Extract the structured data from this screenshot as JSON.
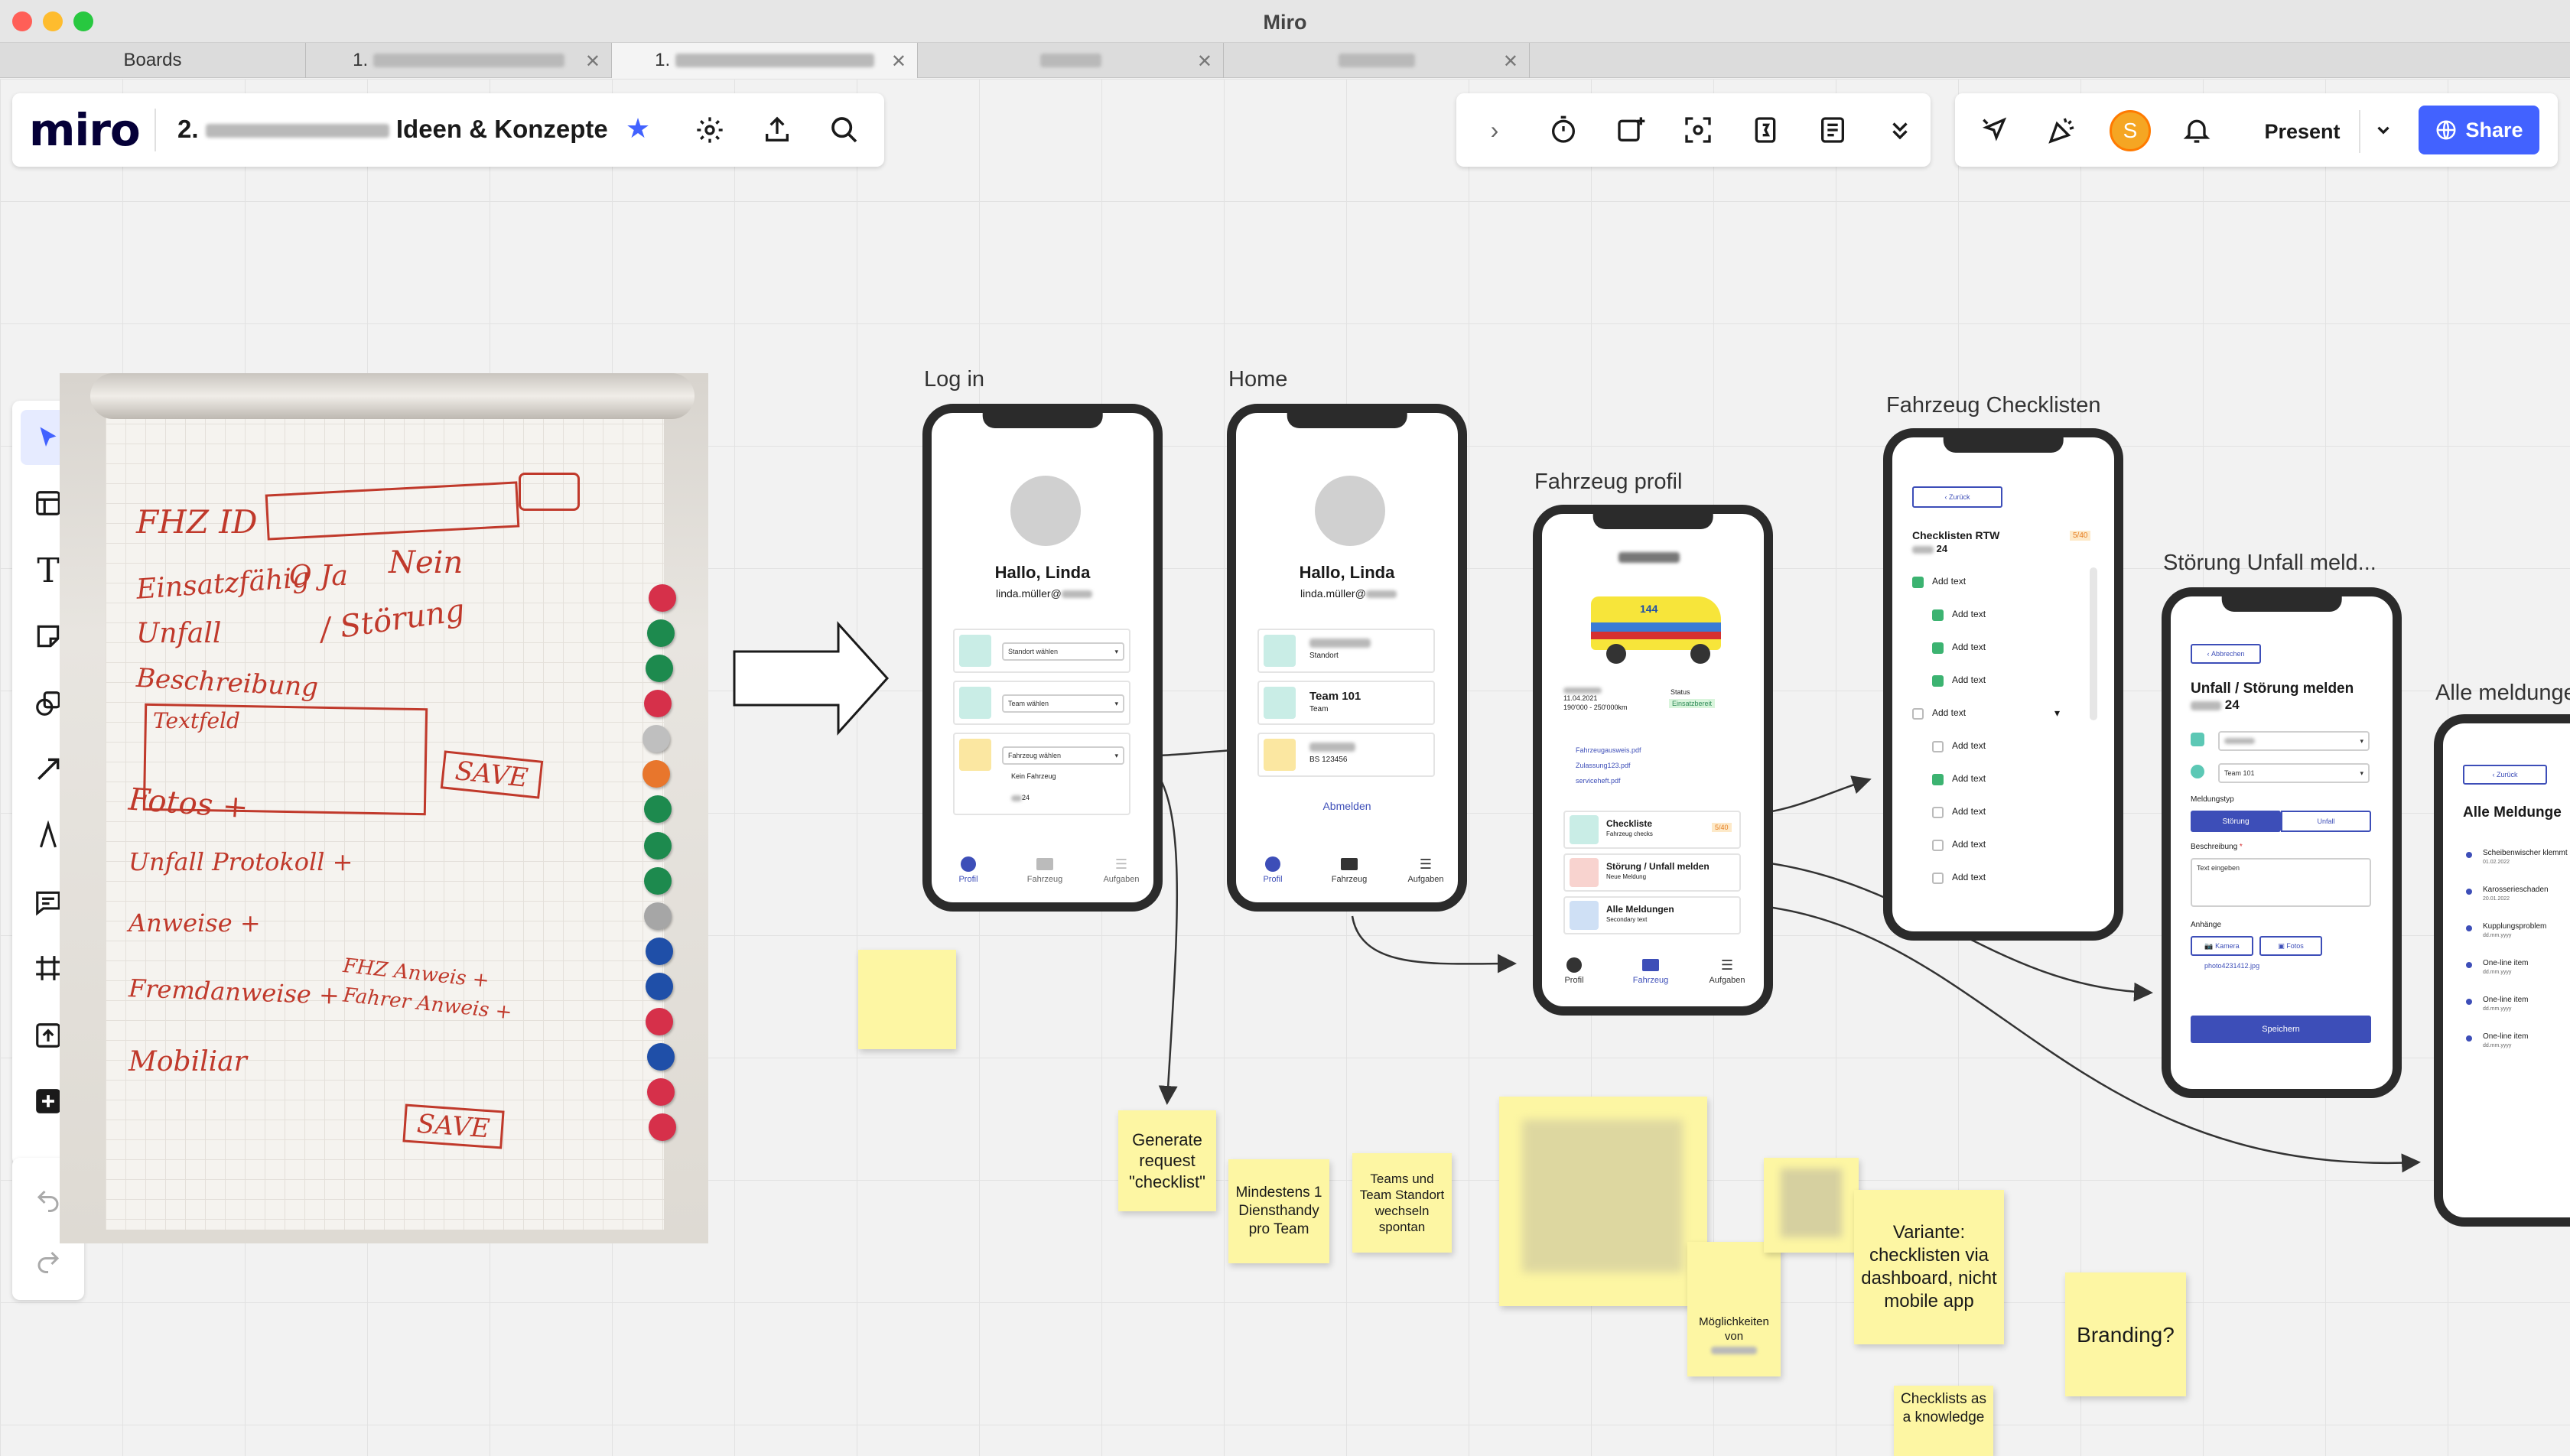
{
  "window": {
    "title": "Miro"
  },
  "tabs": [
    {
      "label": "Boards"
    },
    {
      "label": "1."
    },
    {
      "label": "1."
    },
    {
      "label": ""
    },
    {
      "label": ""
    }
  ],
  "header": {
    "logo": "miro",
    "board_title_prefix": "2.",
    "board_title": "Ideen & Konzepte",
    "present_label": "Present",
    "share_label": "Share",
    "avatar_initial": "S"
  },
  "photo": {
    "lines": [
      "FHZ ID",
      "Einsatzfähig",
      "O Ja",
      "Nein",
      "Unfall",
      "/ Störung",
      "Beschreibung",
      "Textfeld",
      "SAVE",
      "Fotos +",
      "Unfall Protokoll +",
      "Anweise +",
      "Fremdanweise +",
      "FHZ Anweis +",
      "Fahrer Anweis +",
      "Mobiliar",
      "SAVE"
    ]
  },
  "frames": {
    "login": "Log in",
    "home": "Home",
    "fahrzeug_profil": "Fahrzeug profil",
    "checklisten": "Fahrzeug Checklisten",
    "stoerung": "Störung Unfall meld...",
    "alle_meldungen": "Alle meldunge"
  },
  "login": {
    "greeting": "Hallo, Linda",
    "email": "linda.müller@",
    "standort": "Standort wählen",
    "team": "Team wählen",
    "fahrzeug": "Fahrzeug wählen",
    "dropdown_1": "Kein Fahrzeug",
    "dropdown_2": "24",
    "nav": [
      "Profil",
      "Fahrzeug",
      "Aufgaben"
    ]
  },
  "home": {
    "greeting": "Hallo, Linda",
    "email": "linda.müller@",
    "standort_label": "Standort",
    "team_value": "Team 101",
    "team_label": "Team",
    "vehicle_code": "BS 123456",
    "logout": "Abmelden",
    "nav": [
      "Profil",
      "Fahrzeug",
      "Aufgaben"
    ]
  },
  "profil": {
    "vehicle_number": "144",
    "date": "11.04.2021",
    "km": "190'000 - 250'000km",
    "status_label": "Status",
    "status_value": "Einsatzbereit",
    "files": [
      "Fahrzeugausweis.pdf",
      "Zulassung123.pdf",
      "serviceheft.pdf"
    ],
    "cards": [
      {
        "title": "Checkliste",
        "sub": "Fahrzeug checks",
        "badge": "5/40"
      },
      {
        "title": "Störung / Unfall melden",
        "sub": "Neue Meldung",
        "badge": ""
      },
      {
        "title": "Alle Meldungen",
        "sub": "Secondary text",
        "badge": ""
      }
    ],
    "nav": [
      "Profil",
      "Fahrzeug",
      "Aufgaben"
    ]
  },
  "checklisten": {
    "back": "Zurück",
    "title": "Checklisten RTW",
    "subtitle": "24",
    "badge": "5/40",
    "items": [
      {
        "label": "Add text",
        "checked": true,
        "indent": false
      },
      {
        "label": "Add text",
        "checked": true,
        "indent": true
      },
      {
        "label": "Add text",
        "checked": true,
        "indent": true
      },
      {
        "label": "Add text",
        "checked": true,
        "indent": true
      },
      {
        "label": "Add text",
        "checked": false,
        "indent": false
      },
      {
        "label": "Add text",
        "checked": false,
        "indent": true
      },
      {
        "label": "Add text",
        "checked": true,
        "indent": true
      },
      {
        "label": "Add text",
        "checked": false,
        "indent": true
      },
      {
        "label": "Add text",
        "checked": false,
        "indent": true
      },
      {
        "label": "Add text",
        "checked": false,
        "indent": true
      }
    ]
  },
  "stoerung": {
    "back": "Abbrechen",
    "title": "Unfall / Störung melden",
    "subtitle": "24",
    "team": "Team 101",
    "meldungstyp": "Meldungstyp",
    "opt1": "Störung",
    "opt2": "Unfall",
    "beschreibung": "Beschreibung",
    "text_placeholder": "Text eingeben",
    "anhaenge": "Anhänge",
    "kamera": "Kamera",
    "fotos": "Fotos",
    "file": "photo4231412.jpg",
    "save": "Speichern"
  },
  "alle": {
    "back": "Zurück",
    "title": "Alle Meldunge",
    "items": [
      {
        "title": "Scheibenwischer klemmt",
        "date": "01.02.2022"
      },
      {
        "title": "Karosserieschaden",
        "date": "20.01.2022"
      },
      {
        "title": "Kupplungsproblem",
        "date": "dd.mm.yyyy"
      },
      {
        "title": "One-line item",
        "date": "dd.mm.yyyy"
      },
      {
        "title": "One-line item",
        "date": "dd.mm.yyyy"
      },
      {
        "title": "One-line item",
        "date": "dd.mm.yyyy"
      }
    ]
  },
  "stickies": {
    "s1": "Generate request \"checklist\"",
    "s2": "Mindestens 1 Diensthandy pro Team",
    "s3": "Teams und Team Standort wechseln spontan",
    "s4": "Möglichkeiten von",
    "s5": "Variante: checklisten via dashboard, nicht mobile app",
    "s6": "Branding?",
    "s7": "Checklists as a knowledge"
  },
  "colors": {
    "accent": "#4262ff",
    "sticky": "#fdf6a3",
    "primary_app": "#3d4eb8",
    "teal": "#5cc8b5",
    "yellow_icon": "#f7c948"
  }
}
